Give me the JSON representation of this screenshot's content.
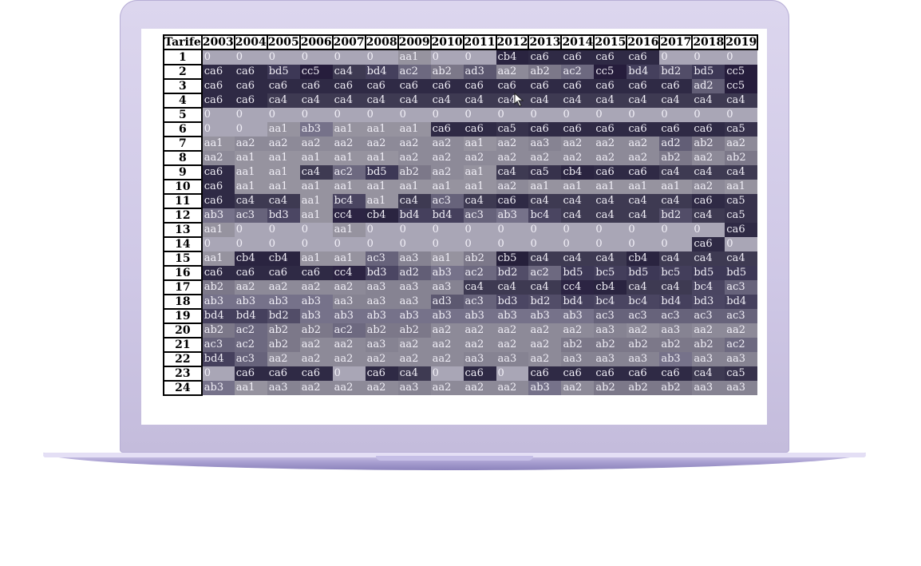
{
  "table": {
    "corner_label": "Tarife",
    "years": [
      "2003",
      "2004",
      "2005",
      "2006",
      "2007",
      "2008",
      "2009",
      "2010",
      "2011",
      "2012",
      "2013",
      "2014",
      "2015",
      "2016",
      "2017",
      "2018",
      "2019"
    ],
    "rows": [
      {
        "label": "1",
        "cells": [
          "0",
          "0",
          "0",
          "0",
          "0",
          "0",
          "aa1",
          "0",
          "0",
          "cb4",
          "ca6",
          "ca6",
          "ca6",
          "ca6",
          "0",
          "0",
          "0"
        ]
      },
      {
        "label": "2",
        "cells": [
          "ca6",
          "ca6",
          "bd5",
          "cc5",
          "ca4",
          "bd4",
          "ac2",
          "ab2",
          "ad3",
          "aa2",
          "ab2",
          "ac2",
          "cc5",
          "bd4",
          "bd2",
          "bd5",
          "cc5"
        ]
      },
      {
        "label": "3",
        "cells": [
          "ca6",
          "ca6",
          "ca6",
          "ca6",
          "ca6",
          "ca6",
          "ca6",
          "ca6",
          "ca6",
          "ca6",
          "ca6",
          "ca6",
          "ca6",
          "ca6",
          "ca6",
          "ad2",
          "cc5"
        ]
      },
      {
        "label": "4",
        "cells": [
          "ca6",
          "ca6",
          "ca4",
          "ca4",
          "ca4",
          "ca4",
          "ca4",
          "ca4",
          "ca4",
          "ca4",
          "ca4",
          "ca4",
          "ca4",
          "ca4",
          "ca4",
          "ca4",
          "ca4"
        ]
      },
      {
        "label": "5",
        "cells": [
          "0",
          "0",
          "0",
          "0",
          "0",
          "0",
          "0",
          "0",
          "0",
          "0",
          "0",
          "0",
          "0",
          "0",
          "0",
          "0",
          "0"
        ]
      },
      {
        "label": "6",
        "cells": [
          "0",
          "0",
          "aa1",
          "ab3",
          "aa1",
          "aa1",
          "aa1",
          "ca6",
          "ca6",
          "ca5",
          "ca6",
          "ca6",
          "ca6",
          "ca6",
          "ca6",
          "ca6",
          "ca5"
        ]
      },
      {
        "label": "7",
        "cells": [
          "aa1",
          "aa2",
          "aa2",
          "aa2",
          "aa2",
          "aa2",
          "aa2",
          "aa2",
          "aa1",
          "aa2",
          "aa3",
          "aa2",
          "aa2",
          "aa2",
          "ad2",
          "ab2",
          "aa2"
        ]
      },
      {
        "label": "8",
        "cells": [
          "aa2",
          "aa1",
          "aa1",
          "aa1",
          "aa1",
          "aa1",
          "aa2",
          "aa2",
          "aa2",
          "aa2",
          "aa2",
          "aa2",
          "aa2",
          "aa2",
          "ab2",
          "aa2",
          "ab2"
        ]
      },
      {
        "label": "9",
        "cells": [
          "ca6",
          "aa1",
          "aa1",
          "ca4",
          "ac2",
          "bd5",
          "ab2",
          "aa2",
          "aa1",
          "ca4",
          "ca5",
          "cb4",
          "ca6",
          "ca6",
          "ca4",
          "ca4",
          "ca4"
        ]
      },
      {
        "label": "10",
        "cells": [
          "ca6",
          "aa1",
          "aa1",
          "aa1",
          "aa1",
          "aa1",
          "aa1",
          "aa1",
          "aa1",
          "aa2",
          "aa1",
          "aa1",
          "aa1",
          "aa1",
          "aa1",
          "aa2",
          "aa1"
        ]
      },
      {
        "label": "11",
        "cells": [
          "ca6",
          "ca4",
          "ca4",
          "aa1",
          "bc4",
          "aa1",
          "ca4",
          "ac3",
          "ca4",
          "ca6",
          "ca4",
          "ca4",
          "ca4",
          "ca4",
          "ca4",
          "ca6",
          "ca5"
        ]
      },
      {
        "label": "12",
        "cells": [
          "ab3",
          "ac3",
          "bd3",
          "aa1",
          "cc4",
          "cb4",
          "bd4",
          "bd4",
          "ac3",
          "ab3",
          "bc4",
          "ca4",
          "ca4",
          "ca4",
          "bd2",
          "ca4",
          "ca5"
        ]
      },
      {
        "label": "13",
        "cells": [
          "aa1",
          "0",
          "0",
          "0",
          "aa1",
          "0",
          "0",
          "0",
          "0",
          "0",
          "0",
          "0",
          "0",
          "0",
          "0",
          "0",
          "ca6"
        ]
      },
      {
        "label": "14",
        "cells": [
          "0",
          "0",
          "0",
          "0",
          "0",
          "0",
          "0",
          "0",
          "0",
          "0",
          "0",
          "0",
          "0",
          "0",
          "0",
          "ca6",
          "0"
        ]
      },
      {
        "label": "15",
        "cells": [
          "aa1",
          "cb4",
          "cb4",
          "aa1",
          "aa1",
          "ac3",
          "aa3",
          "aa1",
          "ab2",
          "cb5",
          "ca4",
          "ca4",
          "ca4",
          "cb4",
          "ca4",
          "ca4",
          "ca4"
        ]
      },
      {
        "label": "16",
        "cells": [
          "ca6",
          "ca6",
          "ca6",
          "ca6",
          "cc4",
          "bd3",
          "ad2",
          "ab3",
          "ac2",
          "bd2",
          "ac2",
          "bd5",
          "bc5",
          "bd5",
          "bc5",
          "bd5",
          "bd5"
        ]
      },
      {
        "label": "17",
        "cells": [
          "ab2",
          "aa2",
          "aa2",
          "aa2",
          "aa2",
          "aa3",
          "aa3",
          "aa3",
          "ca4",
          "ca4",
          "ca4",
          "cc4",
          "cb4",
          "ca4",
          "ca4",
          "bc4",
          "ac3"
        ]
      },
      {
        "label": "18",
        "cells": [
          "ab3",
          "ab3",
          "ab3",
          "ab3",
          "aa3",
          "aa3",
          "aa3",
          "ad3",
          "ac3",
          "bd3",
          "bd2",
          "bd4",
          "bc4",
          "bc4",
          "bd4",
          "bd3",
          "bd4"
        ]
      },
      {
        "label": "19",
        "cells": [
          "bd4",
          "bd4",
          "bd2",
          "ab3",
          "ab3",
          "ab3",
          "ab3",
          "ab3",
          "ab3",
          "ab3",
          "ab3",
          "ab3",
          "ac3",
          "ac3",
          "ac3",
          "ac3",
          "ac3"
        ]
      },
      {
        "label": "20",
        "cells": [
          "ab2",
          "ac2",
          "ab2",
          "ab2",
          "ac2",
          "ab2",
          "ab2",
          "aa2",
          "aa2",
          "aa2",
          "aa2",
          "aa2",
          "aa3",
          "aa2",
          "aa3",
          "aa2",
          "aa2"
        ]
      },
      {
        "label": "21",
        "cells": [
          "ac3",
          "ac2",
          "ab2",
          "aa2",
          "aa2",
          "aa3",
          "aa2",
          "aa2",
          "aa2",
          "aa2",
          "aa2",
          "ab2",
          "ab2",
          "ab2",
          "ab2",
          "ab2",
          "ac2"
        ]
      },
      {
        "label": "22",
        "cells": [
          "bd4",
          "ac3",
          "aa2",
          "aa2",
          "aa2",
          "aa2",
          "aa2",
          "aa2",
          "aa3",
          "aa3",
          "aa2",
          "aa3",
          "aa3",
          "aa3",
          "ab3",
          "aa3",
          "aa3"
        ]
      },
      {
        "label": "23",
        "cells": [
          "0",
          "ca6",
          "ca6",
          "ca6",
          "0",
          "ca6",
          "ca4",
          "0",
          "ca6",
          "0",
          "ca6",
          "ca6",
          "ca6",
          "ca6",
          "ca6",
          "ca4",
          "ca5"
        ]
      },
      {
        "label": "24",
        "cells": [
          "ab3",
          "aa1",
          "aa3",
          "aa2",
          "aa2",
          "aa2",
          "aa3",
          "aa2",
          "aa2",
          "aa2",
          "ab3",
          "aa2",
          "ab2",
          "ab2",
          "ab2",
          "aa3",
          "aa3"
        ]
      }
    ]
  },
  "colors": {
    "0": "#a9a6b6",
    "aa1": "#96939f",
    "aa2": "#8d8a98",
    "aa3": "#868392",
    "ab2": "#7c7889",
    "ab3": "#76728a",
    "ac2": "#6d6980",
    "ac3": "#67637b",
    "ad2": "#625e76",
    "ad3": "#5c5870",
    "bc4": "#4a4561",
    "bc5": "#433e5b",
    "bd2": "#524d68",
    "bd3": "#4b4663",
    "bd4": "#45405d",
    "bd5": "#3d3856",
    "ca4": "#3e3a52",
    "ca5": "#37324c",
    "ca6": "#2f2a45",
    "cb4": "#2a2440",
    "cb5": "#26203b",
    "cc4": "#2c2443",
    "cc5": "#261d3c",
    "default": "#555066"
  }
}
